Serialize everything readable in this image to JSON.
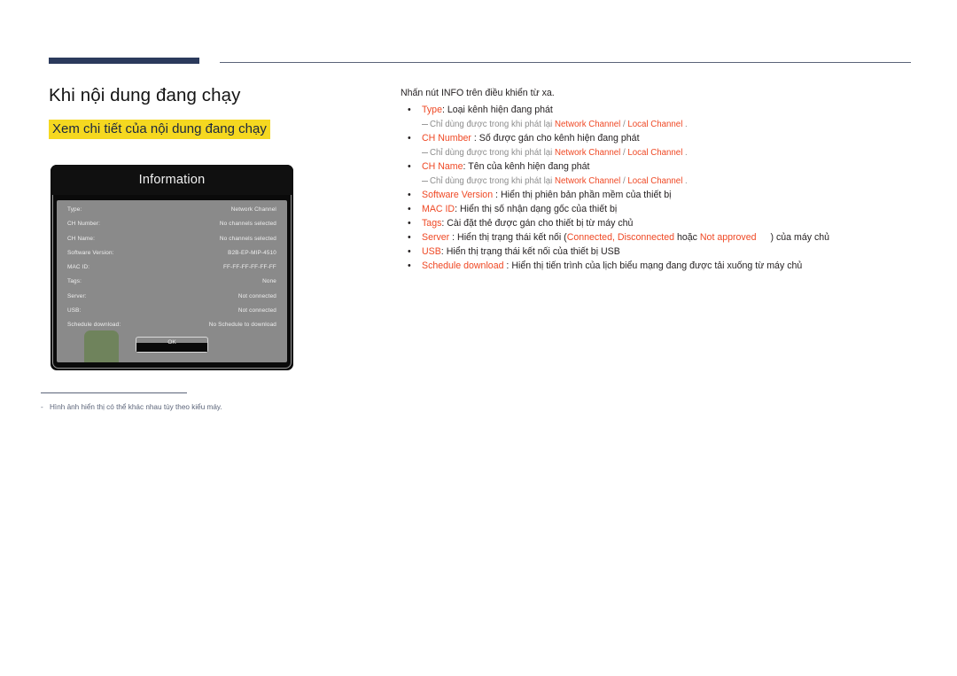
{
  "header": {
    "rule_color": "#2b3a5c",
    "thin_rule_color": "#5b6479"
  },
  "page": {
    "title": "Khi nội dung đang chạy",
    "subtitle": "Xem chi tiết của nội dung đang chạy",
    "subtitle_highlight_color": "#f5d820",
    "accent_color": "#ef4824"
  },
  "dialog": {
    "title": "Information",
    "rows": [
      {
        "label": "Type:",
        "value": "Network Channel"
      },
      {
        "label": "CH Number:",
        "value": "No channels selected"
      },
      {
        "label": "CH Name:",
        "value": "No channels selected"
      },
      {
        "label": "Software Version:",
        "value": "B2B-EP-MIP-4510"
      },
      {
        "label": "MAC ID:",
        "value": "FF-FF-FF-FF-FF-FF"
      },
      {
        "label": "Tags:",
        "value": "None"
      },
      {
        "label": "Server:",
        "value": "Not connected"
      },
      {
        "label": "USB:",
        "value": "Not connected"
      },
      {
        "label": "Schedule download:",
        "value": "No Schedule to download"
      }
    ],
    "ok_label": "OK"
  },
  "footnote": {
    "dash": "-",
    "text": "Hình ảnh hiển thị có thể khác nhau tùy theo kiểu máy."
  },
  "content": {
    "intro": "Nhấn nút INFO trên điều khiển từ xa.",
    "bullet_char": "•",
    "items": [
      {
        "keyword": "Type",
        "sep": ": ",
        "description": "Loại kênh hiện đang phát",
        "note": {
          "lead": "Chỉ dùng được trong khi phát lại ",
          "kw1": "Network Channel",
          "mid": " / ",
          "kw2": "Local Channel",
          "tail": " ."
        }
      },
      {
        "keyword": "CH Number",
        "sep": " : ",
        "description": "Số được gán cho kênh hiện đang phát",
        "note": {
          "lead": "Chỉ dùng được trong khi phát lại ",
          "kw1": "Network Channel",
          "mid": " / ",
          "kw2": "Local Channel",
          "tail": " ."
        }
      },
      {
        "keyword": "CH Name",
        "sep": ": ",
        "description": "Tên của kênh hiện đang phát",
        "note": {
          "lead": "Chỉ dùng được trong khi phát lại ",
          "kw1": "Network Channel",
          "mid": " / ",
          "kw2": "Local Channel",
          "tail": " ."
        }
      },
      {
        "keyword": "Software Version",
        "sep": " : ",
        "description": "Hiển thị phiên bản phần mềm của thiết bị"
      },
      {
        "keyword": "MAC ID",
        "sep": ": ",
        "description": "Hiển thị số nhận dạng gốc của thiết bị"
      },
      {
        "keyword": "Tags",
        "sep": ": ",
        "description": "Cài đặt thẻ được gán cho thiết bị từ máy chủ"
      },
      {
        "keyword": "Server",
        "sep": " : ",
        "description_pre": "Hiển thị trạng thái kết nối (",
        "inline_kw1": "Connected, Disconnected",
        "description_mid": " hoặc ",
        "inline_kw2": "Not approved",
        "description_post": ") của máy chủ"
      },
      {
        "keyword": "USB",
        "sep": ": ",
        "description": "Hiển thị trạng thái kết nối của thiết bị USB"
      },
      {
        "keyword": "Schedule download",
        "sep": " : ",
        "description": "Hiển thị tiến trình của lịch biểu mạng đang được tải xuống từ máy chủ"
      }
    ]
  }
}
